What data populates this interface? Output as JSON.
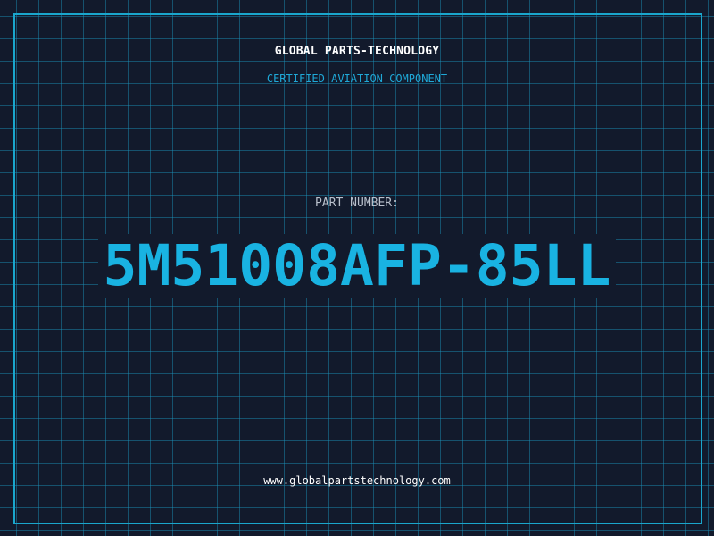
{
  "header": {
    "company": "GLOBAL PARTS-TECHNOLOGY",
    "tagline": "CERTIFIED AVIATION COMPONENT"
  },
  "part": {
    "label": "PART NUMBER:",
    "number": "5M51008AFP-85LL"
  },
  "footer": {
    "website": "www.globalpartstechnology.com"
  },
  "colors": {
    "background": "#121a2c",
    "grid": "#1a96be",
    "accent": "#19b3e2",
    "frame": "#1aa6cc"
  }
}
